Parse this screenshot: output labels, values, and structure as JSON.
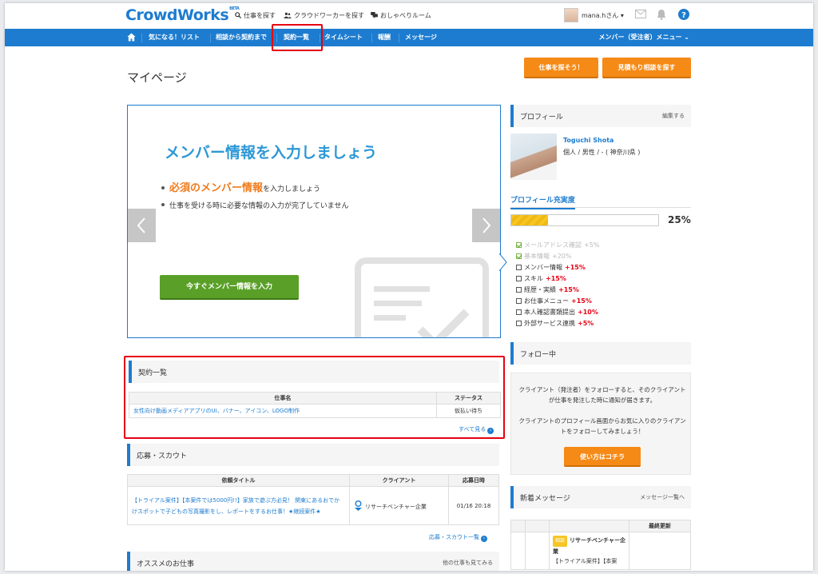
{
  "header": {
    "logo": "CrowdWorks",
    "logo_beta": "BETA",
    "links": [
      "仕事を探す",
      "クラウドワーカーを探す",
      "おしゃべりルーム"
    ],
    "username": "mana.hさん"
  },
  "nav": {
    "items": [
      "気になる！リスト",
      "相談から契約まで",
      "契約一覧",
      "タイムシート",
      "報酬",
      "メッセージ"
    ],
    "menu": "メンバー（受注者）メニュー"
  },
  "page": {
    "title": "マイページ",
    "find_job_button": "仕事を探そう！",
    "estimate_button": "見積もり相談を探す"
  },
  "hero": {
    "title": "メンバー情報を入力しましょう",
    "bullet1_em": "必須のメンバー情報",
    "bullet1_rest": "を入力しましょう",
    "bullet2": "仕事を受ける時に必要な情報の入力が完了していません",
    "button": "今すぐメンバー情報を入力"
  },
  "contracts": {
    "title": "契約一覧",
    "headers": [
      "仕事名",
      "ステータス"
    ],
    "rows": [
      {
        "name": "女性向け動画メディアアプリのUI、バナー、アイコン、LOGO制作",
        "status": "仮払い待ち"
      }
    ],
    "more": "すべて見る"
  },
  "applications": {
    "title": "応募・スカウト",
    "headers": [
      "依頼タイトル",
      "クライアント",
      "応募日時"
    ],
    "rows": [
      {
        "title": "【トライアル案件】【本案件では5000円!!】家族で遊ぶ方必見！ 関東にあるおでかけスポットで子どもの写真撮影をし、レポートをするお仕事！★継続案件★",
        "client": "リサーチベンチャー企業",
        "date": "01/16 20:18"
      }
    ],
    "more": "応募・スカウト一覧"
  },
  "recommended": {
    "title": "オススメのお仕事",
    "more": "他の仕事も見てみる"
  },
  "profile": {
    "title": "プロフィール",
    "edit": "編集する",
    "name": "Toguchi Shota",
    "info": "個人 / 男性 / - ( 神奈川県 )",
    "fill_title": "プロフィール充実度",
    "fill_percent": 25,
    "fill_label": "25%",
    "checklist": [
      {
        "label": "メールアドレス確認",
        "points": "+5%",
        "done": true
      },
      {
        "label": "基本情報",
        "points": "+20%",
        "done": true
      },
      {
        "label": "メンバー情報",
        "points": "+15%",
        "done": false
      },
      {
        "label": "スキル",
        "points": "+15%",
        "done": false
      },
      {
        "label": "経歴・実績",
        "points": "+15%",
        "done": false
      },
      {
        "label": "お仕事メニュー",
        "points": "+15%",
        "done": false
      },
      {
        "label": "本人確認書類提出",
        "points": "+10%",
        "done": false
      },
      {
        "label": "外部サービス連携",
        "points": "+5%",
        "done": false
      }
    ]
  },
  "follow": {
    "title": "フォロー中",
    "text1": "クライアント（発注者）をフォローすると、そのクライアントが仕事を発注した時に通知が届きます。",
    "text2": "クライアントのプロフィール画面からお気に入りのクライアントをフォローしてみましょう！",
    "button": "使い方はコチラ"
  },
  "messages": {
    "title": "新着メッセージ",
    "more": "メッセージ一覧へ",
    "header_last": "最終更新",
    "badge": "相談",
    "sender": "リサーチベンチャー企業",
    "preview": "【トライアル案件】【本案"
  },
  "colors": {
    "brand": "#1d7ccf",
    "accent": "#f68a16",
    "green": "#5aa028",
    "alert": "#e60012"
  }
}
